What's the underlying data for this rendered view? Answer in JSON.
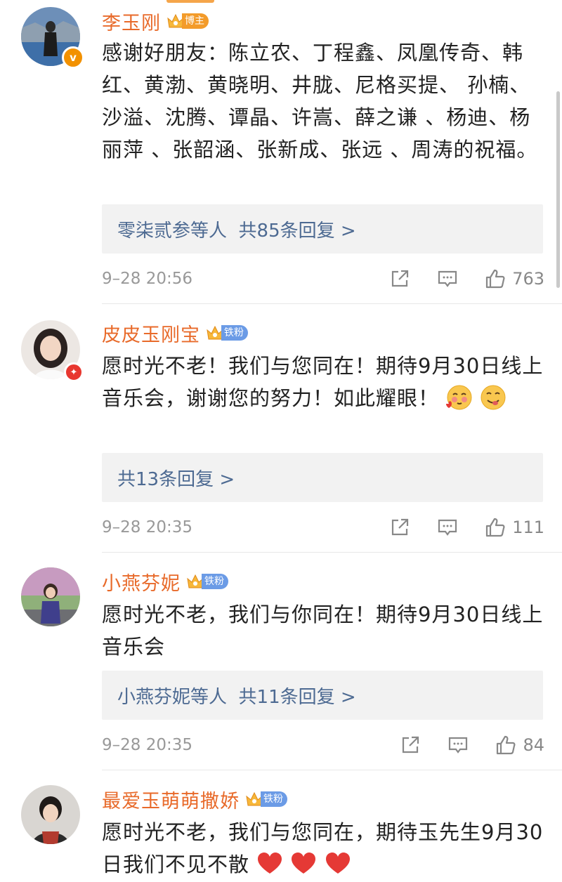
{
  "colors": {
    "username": "#e86a2a",
    "reply_link": "#4d6a92",
    "fan_badge": "#6b9be6",
    "bozhu_badge": "#f39b2a"
  },
  "comments": [
    {
      "username": "李玉刚",
      "badge": "博主",
      "verified_icon": "verified-v-icon",
      "text": "感谢好朋友：陈立农、丁程鑫、凤凰传奇、韩红、黄渤、黄晓明、井胧、尼格买提、 孙楠、 沙溢、沈腾、谭晶、许嵩、薛之谦 、杨迪、杨丽萍 、张韶涵、张新成、张远 、周涛的祝福。",
      "reply": "零柒贰参等人  共85条回复 >",
      "time": "9–28 20:56",
      "likes": "763"
    },
    {
      "username": "皮皮玉刚宝",
      "badge": "铁粉",
      "text": "愿时光不老！我们与您同在！期待9月30日线上音乐会，谢谢您的努力！如此耀眼！",
      "reply": "共13条回复 >",
      "time": "9–28 20:35",
      "likes": "111"
    },
    {
      "username": "小燕芬妮",
      "badge": "铁粉",
      "text": "愿时光不老，我们与你同在！期待9月30日线上音乐会",
      "reply": "小燕芬妮等人  共11条回复 >",
      "time": "9–28 20:35",
      "likes": "84"
    },
    {
      "username": "最爱玉萌萌撒娇",
      "badge": "铁粉",
      "text": "愿时光不老，我们与您同在，期待玉先生9月30日我们不见不散"
    }
  ]
}
